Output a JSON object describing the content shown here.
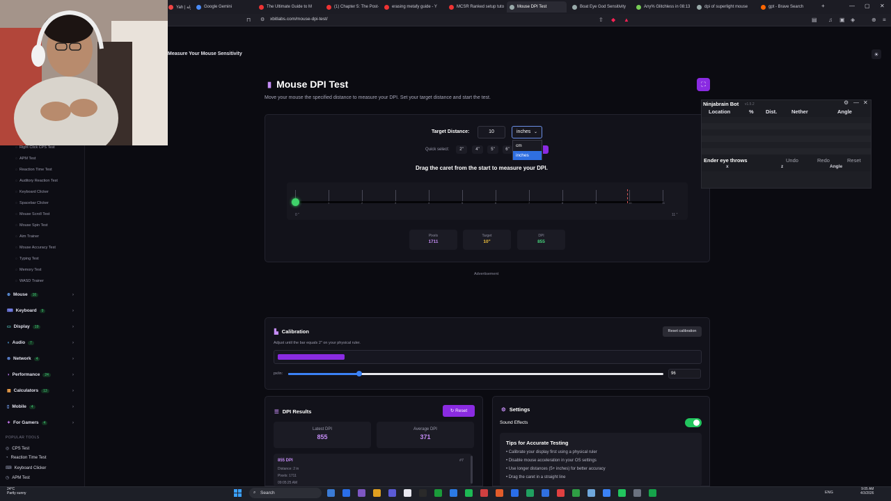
{
  "browser": {
    "tabs": [
      {
        "label": "Yah | جولة",
        "color": "#e44"
      },
      {
        "label": "Google Gemini",
        "color": "#4a8cf7"
      },
      {
        "label": "The Ultimate Guide to M",
        "color": "#e33"
      },
      {
        "label": "(1) Chapter 5: The Post-",
        "color": "#e33"
      },
      {
        "label": "erasing metafy guide - Y",
        "color": "#e33"
      },
      {
        "label": "MCSR Ranked setup tuto",
        "color": "#e33"
      },
      {
        "label": "Mouse DPI Test",
        "color": "#9aa"
      },
      {
        "label": "Boat Eye God Sensitivity",
        "color": "#9aa"
      },
      {
        "label": "Any% Glitchless in 08:13",
        "color": "#7c5"
      },
      {
        "label": "dpi of superlight mouse",
        "color": "#9aa"
      },
      {
        "label": "gpt - Brave Search",
        "color": "#f60"
      }
    ],
    "new_tab": "+",
    "url": "xbitlabs.com/mouse-dpi-test/"
  },
  "site": {
    "header_title": "Measure Your Mouse Sensitivity"
  },
  "sidebar": {
    "subitems": [
      "Right Click CPS Test",
      "APM Test",
      "Reaction Time Test",
      "Auditory Reaction Test",
      "Keyboard Clicker",
      "Spacebar Clicker",
      "Mouse Scroll Test",
      "Mouse Spin Test",
      "Aim Trainer",
      "Mouse Accuracy Test",
      "Typing Test",
      "Memory Test",
      "WASD Trainer"
    ],
    "categories": [
      {
        "label": "Mouse",
        "count": "16",
        "icon": "⊕"
      },
      {
        "label": "Keyboard",
        "count": "9",
        "icon": "⌨"
      },
      {
        "label": "Display",
        "count": "19",
        "icon": "▭"
      },
      {
        "label": "Audio",
        "count": "7",
        "icon": "◖"
      },
      {
        "label": "Network",
        "count": "4",
        "icon": "⊗"
      },
      {
        "label": "Performance",
        "count": "24",
        "icon": "◑"
      },
      {
        "label": "Calculators",
        "count": "13",
        "icon": "▦"
      },
      {
        "label": "Mobile",
        "count": "4",
        "icon": "▯"
      },
      {
        "label": "For Gamers",
        "count": "4",
        "icon": "✦"
      }
    ],
    "popular_title": "POPULAR TOOLS",
    "popular": [
      "CPS Test",
      "Reaction Time Test",
      "Keyboard Clicker",
      "APM Test"
    ]
  },
  "main": {
    "title": "Mouse DPI Test",
    "subtitle": "Move your mouse the specified distance to measure your DPI. Set your target distance and start the test.",
    "target_distance_label": "Target Distance:",
    "target_distance_value": "10",
    "unit_selected": "inches",
    "unit_options": [
      "cm",
      "inches"
    ],
    "quick_select_label": "Quick select:",
    "quick_options": [
      "2\"",
      "4\"",
      "5\"",
      "6\""
    ],
    "drag_instruction": "Drag the caret from the start to measure your DPI.",
    "ruler_ticks": [
      "0",
      "1",
      "2",
      "3",
      "4",
      "5",
      "6",
      "7",
      "8",
      "9",
      "10",
      "11"
    ],
    "ruler_start": "0 \"",
    "ruler_end": "11 \"",
    "stats": [
      {
        "label": "Pixels",
        "value": "1711",
        "color": "#c48cf5"
      },
      {
        "label": "Target",
        "value": "10\"",
        "color": "#f0c03c"
      },
      {
        "label": "DPI",
        "value": "855",
        "color": "#45d07a"
      }
    ],
    "ad_label": "Advertisement"
  },
  "ninjabrain": {
    "title": "Ninjabrain Bot",
    "version": "v1.5.2",
    "columns": [
      "Location",
      "%",
      "Dist.",
      "Nether",
      "Angle"
    ],
    "eye_throws": "Ender eye throws",
    "undo": "Undo",
    "redo": "Redo",
    "reset": "Reset",
    "sub_cols": [
      "x",
      "z",
      "Angle"
    ]
  },
  "calibration": {
    "title": "Calibration",
    "subtitle": "Adjust until the bar equals 2\" on your physical ruler.",
    "reset_label": "Reset calibration",
    "px_label": "px/in:",
    "px_value": "96",
    "slider_fraction": 0.19
  },
  "results": {
    "title": "DPI Results",
    "reset_label": "Reset",
    "latest_label": "Latest DPI",
    "latest_value": "855",
    "average_label": "Average DPI",
    "average_value": "371",
    "entry": {
      "dpi": "855 DPI",
      "number": "#7",
      "distance": "Distance: 2 in",
      "pixels": "Pixels: 1711",
      "time": "09:05:25 AM"
    }
  },
  "settings": {
    "title": "Settings",
    "sound_label": "Sound Effects",
    "sound_on": true,
    "tips_title": "Tips for Accurate Testing",
    "tips": [
      "• Calibrate your display first using a physical ruler",
      "• Disable mouse acceleration in your OS settings",
      "• Use longer distances (5+ inches) for better accuracy",
      "• Drag the caret in a straight line"
    ]
  },
  "taskbar": {
    "weather_temp": "24°C",
    "weather_desc": "Partly sunny",
    "search": "Search",
    "lang": "ENG",
    "time": "9:05 AM",
    "date": "4/3/2026"
  }
}
